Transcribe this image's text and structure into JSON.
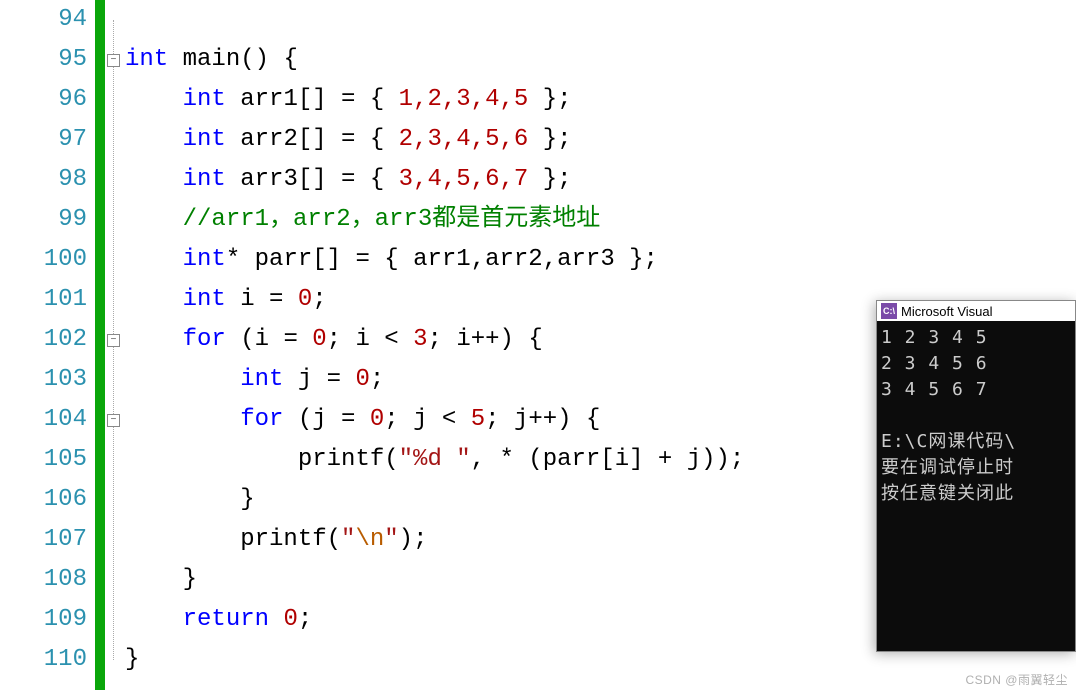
{
  "editor": {
    "lines": [
      "94",
      "95",
      "96",
      "97",
      "98",
      "99",
      "100",
      "101",
      "102",
      "103",
      "104",
      "105",
      "106",
      "107",
      "108",
      "109",
      "110"
    ]
  },
  "code": {
    "kw_int": "int",
    "kw_for": "for",
    "kw_return": "return",
    "main": "main",
    "arr1": "arr1",
    "arr2": "arr2",
    "arr3": "arr3",
    "parr": "parr",
    "printf": "printf",
    "i": "i",
    "j": "j",
    "comment": "//arr1，arr2，arr3都是首元素地址",
    "vals1": "1,2,3,4,5",
    "vals2": "2,3,4,5,6",
    "vals3": "3,4,5,6,7",
    "zero": "0",
    "three": "3",
    "five": "5",
    "fmt_d": "\"%d \"",
    "nl_open": "\"",
    "nl_esc": "\\n",
    "nl_close": "\""
  },
  "console": {
    "title": "Microsoft Visual",
    "row1": "1 2 3 4 5",
    "row2": "2 3 4 5 6",
    "row3": "3 4 5 6 7",
    "path": "E:\\C网课代码\\",
    "msg1": "要在调试停止时",
    "msg2": "按任意键关闭此"
  },
  "watermark": "CSDN @雨翼轻尘"
}
